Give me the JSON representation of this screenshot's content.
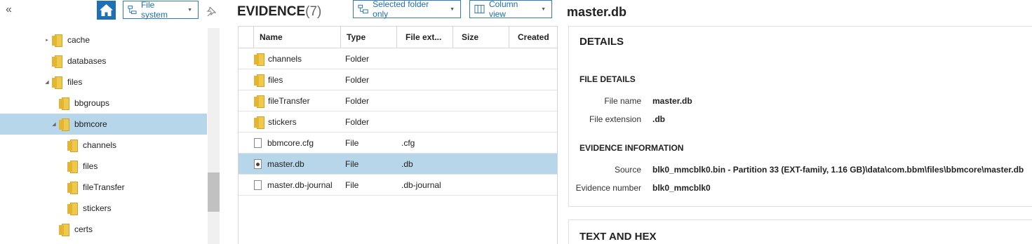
{
  "left": {
    "collapse_glyph": "«",
    "source_dropdown": "File system",
    "tree": [
      {
        "label": "cache",
        "level": 1,
        "expander": "▸"
      },
      {
        "label": "databases",
        "level": 1,
        "expander": ""
      },
      {
        "label": "files",
        "level": 1,
        "expander": "◢"
      },
      {
        "label": "bbgroups",
        "level": 2,
        "expander": ""
      },
      {
        "label": "bbmcore",
        "level": 2,
        "expander": "◢",
        "selected": true
      },
      {
        "label": "channels",
        "level": 3,
        "expander": ""
      },
      {
        "label": "files",
        "level": 3,
        "expander": ""
      },
      {
        "label": "fileTransfer",
        "level": 3,
        "expander": ""
      },
      {
        "label": "stickers",
        "level": 3,
        "expander": ""
      },
      {
        "label": "certs",
        "level": 2,
        "expander": ""
      }
    ]
  },
  "evidence": {
    "title": "EVIDENCE",
    "count": "(7)",
    "filter_dropdown": "Selected folder only",
    "view_dropdown": "Column view",
    "columns": [
      "Name",
      "Type",
      "File ext...",
      "Size",
      "Created"
    ],
    "rows": [
      {
        "name": "channels",
        "type": "Folder",
        "ext": "",
        "icon": "folder-icon"
      },
      {
        "name": "files",
        "type": "Folder",
        "ext": "",
        "icon": "folder-icon"
      },
      {
        "name": "fileTransfer",
        "type": "Folder",
        "ext": "",
        "icon": "folder-icon"
      },
      {
        "name": "stickers",
        "type": "Folder",
        "ext": "",
        "icon": "folder-icon"
      },
      {
        "name": "bbmcore.cfg",
        "type": "File",
        "ext": ".cfg",
        "icon": "file-icon"
      },
      {
        "name": "master.db",
        "type": "File",
        "ext": ".db",
        "icon": "database-file-icon",
        "selected": true
      },
      {
        "name": "master.db-journal",
        "type": "File",
        "ext": ".db-journal",
        "icon": "file-icon"
      }
    ]
  },
  "details": {
    "title": "master.db",
    "card_title": "DETAILS",
    "file_details_header": "FILE DETAILS",
    "file_name_label": "File name",
    "file_name_value": "master.db",
    "file_ext_label": "File extension",
    "file_ext_value": ".db",
    "evidence_info_header": "EVIDENCE INFORMATION",
    "source_label": "Source",
    "source_value": "blk0_mmcblk0.bin - Partition 33 (EXT-family, 1.16 GB)\\data\\com.bbm\\files\\bbmcore\\master.db",
    "evidence_number_label": "Evidence number",
    "evidence_number_value": "blk0_mmcblk0",
    "text_hex_title": "TEXT AND HEX"
  },
  "colors": {
    "accent": "#1f6fb5",
    "selection": "#b8d6ea"
  }
}
